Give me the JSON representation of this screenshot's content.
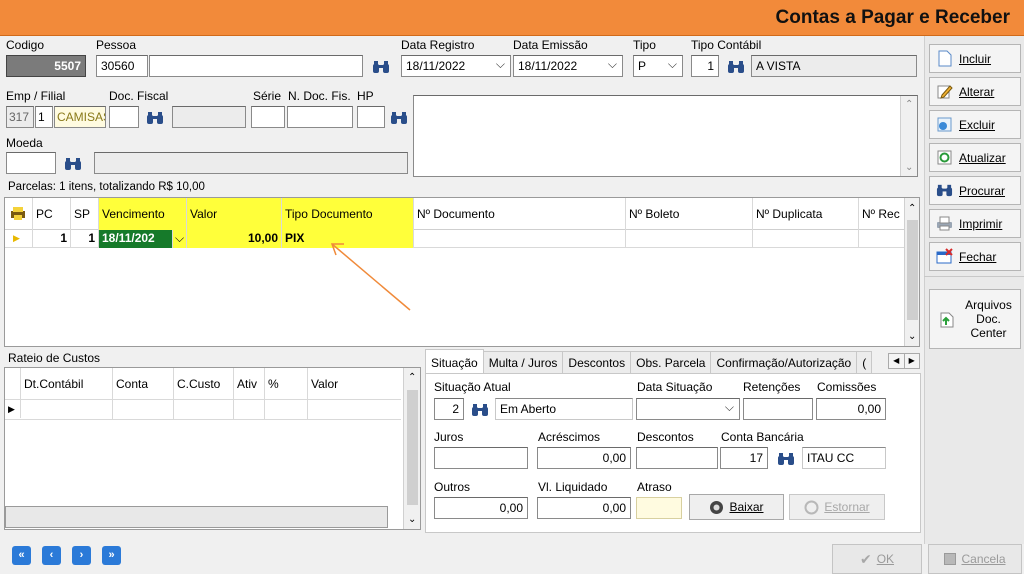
{
  "window": {
    "title": "Contas a Pagar e Receber"
  },
  "header": {
    "codigo_label": "Codigo",
    "codigo_value": "5507",
    "pessoa_label": "Pessoa",
    "pessoa_code": "30560",
    "pessoa_name": "",
    "data_registro_label": "Data Registro",
    "data_registro": "18/11/2022",
    "data_emissao_label": "Data Emissão",
    "data_emissao": "18/11/2022",
    "tipo_label": "Tipo",
    "tipo_value": "P",
    "tipo_contabil_label": "Tipo Contábil",
    "tipo_contabil_code": "1",
    "tipo_contabil_name": "A VISTA",
    "emp_filial_label": "Emp / Filial",
    "emp": "317",
    "filial": "1",
    "filial_name": "CAMISAS",
    "doc_fiscal_label": "Doc. Fiscal",
    "serie_label": "Série",
    "n_doc_fis_label": "N. Doc. Fis.",
    "hp_label": "HP",
    "moeda_label": "Moeda"
  },
  "parcelas": {
    "summary": "Parcelas: 1 itens, totalizando R$ 10,00",
    "columns": [
      "PC",
      "SP",
      "Vencimento",
      "Valor",
      "Tipo Documento",
      "Nº Documento",
      "Nº Boleto",
      "Nº Duplicata",
      "Nº Rec"
    ],
    "rows": [
      {
        "pc": "1",
        "sp": "1",
        "vencimento": "18/11/202",
        "valor": "10,00",
        "tipo_documento": "PIX"
      }
    ]
  },
  "rateio": {
    "title": "Rateio de Custos",
    "columns": [
      "Dt.Contábil",
      "Conta",
      "C.Custo",
      "Ativ",
      "%",
      "Valor"
    ]
  },
  "tabs": [
    "Situação",
    "Multa / Juros",
    "Descontos",
    "Obs. Parcela",
    "Confirmação/Autorização",
    "("
  ],
  "situacao": {
    "situacao_atual_label": "Situação Atual",
    "situacao_code": "2",
    "situacao_name": "Em Aberto",
    "data_situacao_label": "Data Situação",
    "retencoes_label": "Retenções",
    "comissoes_label": "Comissões",
    "comissoes_value": "0,00",
    "juros_label": "Juros",
    "acrescimos_label": "Acréscimos",
    "acrescimos_value": "0,00",
    "descontos_label": "Descontos",
    "conta_bancaria_label": "Conta Bancária",
    "conta_code": "17",
    "conta_name": "ITAU CC",
    "outros_label": "Outros",
    "outros_value": "0,00",
    "vl_liquidado_label": "Vl. Liquidado",
    "vl_liquidado_value": "0,00",
    "atraso_label": "Atraso",
    "baixar_label": "Baixar",
    "estornar_label": "Estornar"
  },
  "sidebar": {
    "incluir": "Incluir",
    "alterar": "Alterar",
    "excluir": "Excluir",
    "atualizar": "Atualizar",
    "procurar": "Procurar",
    "imprimir": "Imprimir",
    "fechar": "Fechar",
    "arquivos": "Arquivos Doc. Center"
  },
  "footer": {
    "ok": "OK",
    "cancela": "Cancela"
  }
}
